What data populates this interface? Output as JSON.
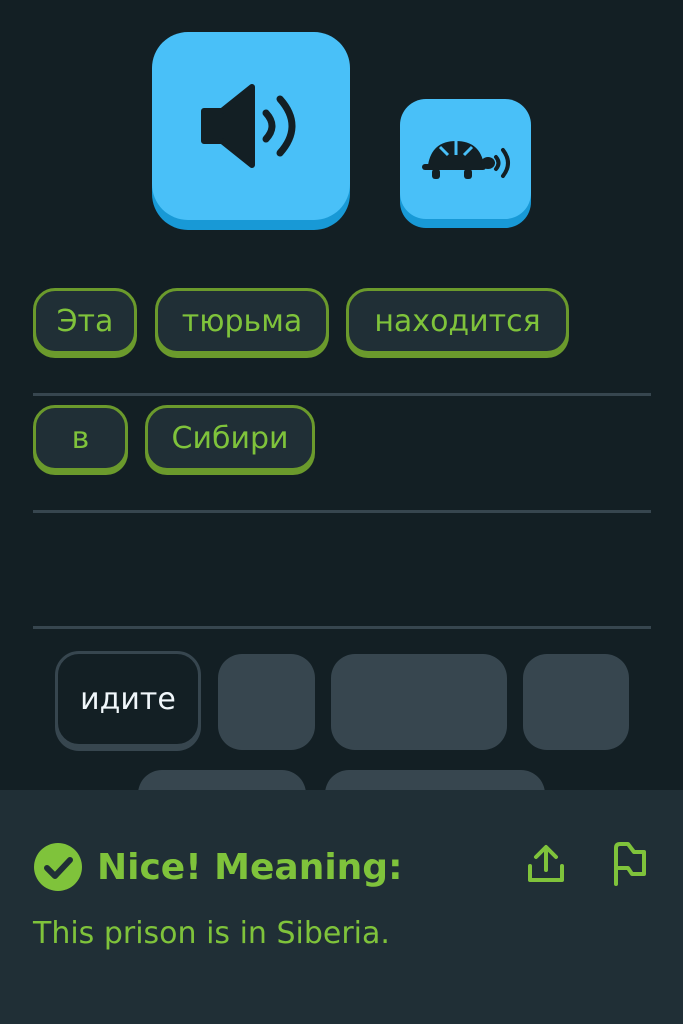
{
  "prompt": {
    "audio_icon": "speaker-icon",
    "slow_audio_icon": "turtle-icon"
  },
  "answer": {
    "line1": [
      "Эта",
      "тюрьма",
      "находится"
    ],
    "line2": [
      "в",
      "Сибири"
    ]
  },
  "word_bank": {
    "visible_word": "идите"
  },
  "feedback": {
    "title": "Nice! Meaning:",
    "translation": "This prison is in Siberia.",
    "check_icon": "check-circle-icon",
    "share_icon": "share-icon",
    "flag_icon": "flag-icon"
  },
  "colors": {
    "background": "#131f24",
    "accent_blue": "#49c0f8",
    "success_green": "#7fc33b",
    "chip_border_green": "#6b9a2c",
    "panel": "#202f36"
  }
}
